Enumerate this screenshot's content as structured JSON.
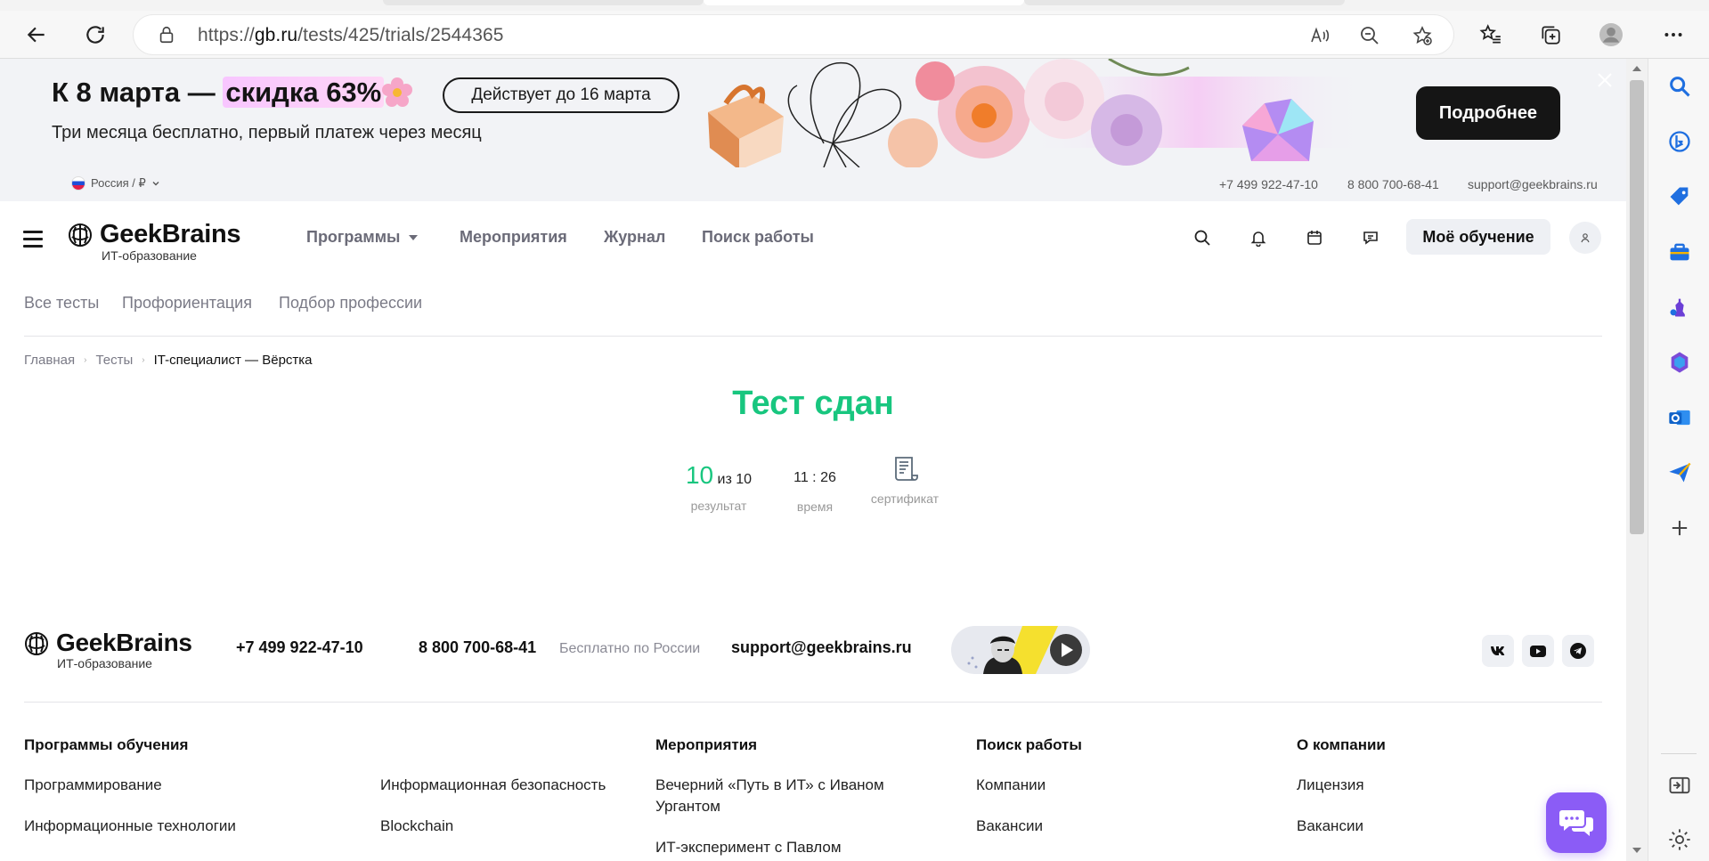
{
  "browser": {
    "url_prefix": "https://",
    "url_domain": "gb.ru",
    "url_path": "/tests/425/trials/2544365"
  },
  "promo": {
    "title_start": "К 8 марта — ",
    "title_highlight": "скидка 63%",
    "pill": "Действует до 16 марта",
    "subtitle": "Три месяца бесплатно, первый платеж через месяц",
    "button": "Подробнее"
  },
  "utility": {
    "region": "Россия / ₽",
    "phone1": "+7 499 922-47-10",
    "phone2": "8 800 700-68-41",
    "email": "support@geekbrains.ru"
  },
  "header": {
    "logo_name": "GeekBrains",
    "logo_sub": "ИТ-образование",
    "nav": [
      "Программы",
      "Мероприятия",
      "Журнал",
      "Поиск работы"
    ],
    "my_learning": "Моё обучение"
  },
  "subnav": [
    "Все тесты",
    "Профориентация",
    "Подбор профессии"
  ],
  "breadcrumb": {
    "home": "Главная",
    "tests": "Тесты",
    "current": "IT-специалист — Вёрстка"
  },
  "result": {
    "title": "Тест сдан",
    "score": "10",
    "score_of": "из 10",
    "score_label": "результат",
    "time": "11 : 26",
    "time_label": "время",
    "cert_label": "сертификат"
  },
  "footer": {
    "logo_name": "GeekBrains",
    "logo_sub": "ИТ-образование",
    "phone1": "+7 499 922-47-10",
    "phone2": "8 800 700-68-41",
    "phone2_note": "Бесплатно по России",
    "email": "support@geekbrains.ru",
    "col1_title": "Программы обучения",
    "col1_links": [
      "Программирование",
      "Информационные технологии"
    ],
    "col1b_links": [
      "Информационная безопасность",
      "Blockchain"
    ],
    "col2_title": "Мероприятия",
    "col2_links": [
      "Вечерний «Путь в ИТ» с Иваном Ургантом",
      "ИТ-эксперимент с Павлом"
    ],
    "col3_title": "Поиск работы",
    "col3_links": [
      "Компании",
      "Вакансии"
    ],
    "col4_title": "О компании",
    "col4_links": [
      "Лицензия",
      "Вакансии"
    ]
  },
  "colors": {
    "accent_green": "#18c67f",
    "chat_purple": "#8b5cf6"
  }
}
